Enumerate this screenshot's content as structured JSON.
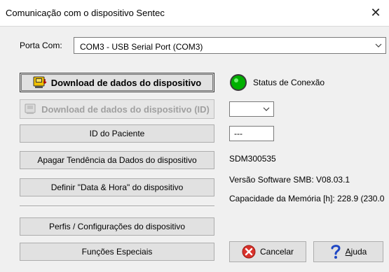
{
  "window": {
    "title": "Comunicação com o dispositivo Sentec"
  },
  "port": {
    "label": "Porta Com:",
    "value": "COM3 - USB Serial Port (COM3)"
  },
  "buttons": {
    "download": "Download de dados do dispositivo",
    "download_id": "Download de dados do dispositivo (ID)",
    "patient_id": "ID do Paciente",
    "erase_trend": "Apagar Tendência da Dados do dispositivo",
    "set_datetime": "Definir \"Data & Hora\" do dispositivo",
    "profiles": "Perfis / Configurações do dispositivo",
    "special": "Funções Especiais",
    "cancel": "Cancelar",
    "help_prefix": "",
    "help_mnemonic": "A",
    "help_rest": "juda"
  },
  "status": {
    "label": "Status de Conexão",
    "color": "#00b000"
  },
  "id_select": {
    "value": ""
  },
  "patient_id_box": {
    "value": "---"
  },
  "device": {
    "serial": "SDM300535",
    "software": "Versão Software SMB: V08.03.1",
    "memory": "Capacidade da Memória [h]: 228.9 (230.0"
  },
  "icons": {
    "download": "device-download-icon",
    "download_id": "device-download-id-icon",
    "status": "status-led-icon",
    "cancel": "cancel-x-icon",
    "help": "question-mark-icon",
    "close": "close-icon"
  }
}
